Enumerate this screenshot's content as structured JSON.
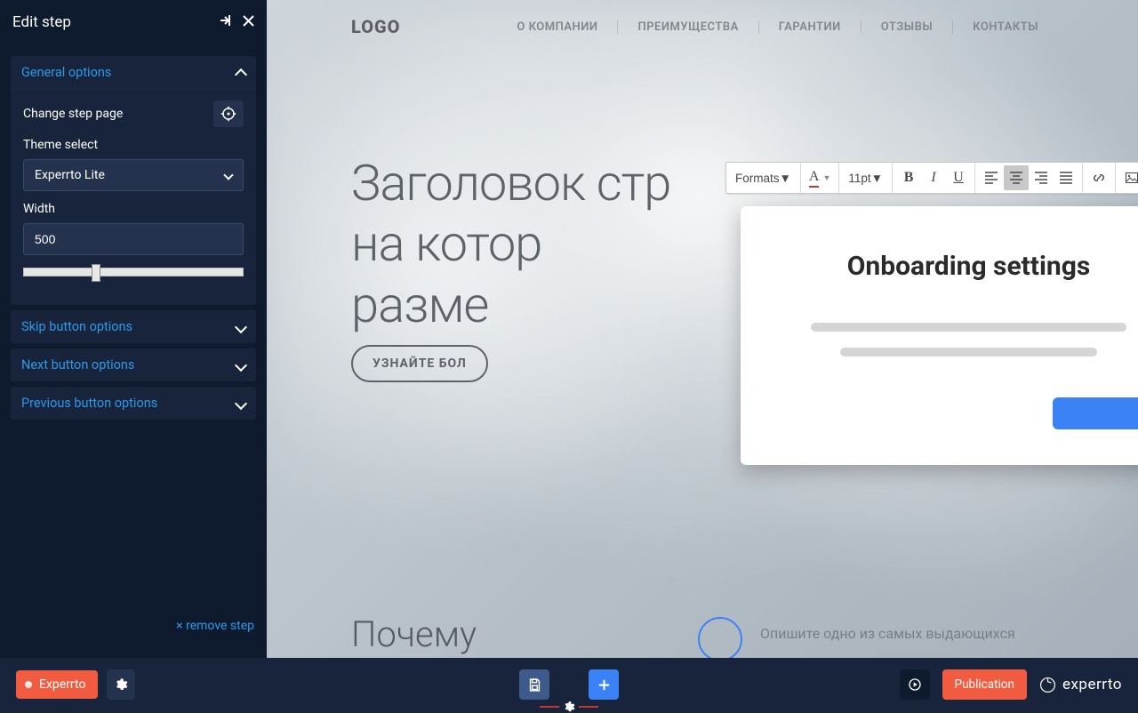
{
  "sidebar": {
    "title": "Edit step",
    "remove": "× remove step",
    "sections": {
      "general": {
        "label": "General options",
        "change_page": "Change step page",
        "theme_label": "Theme select",
        "theme_value": "Experrto Lite",
        "width_label": "Width",
        "width_value": "500"
      },
      "skip": {
        "label": "Skip button options"
      },
      "next": {
        "label": "Next button options"
      },
      "prev": {
        "label": "Previous button options"
      }
    }
  },
  "toolbar": {
    "formats": "Formats",
    "font_size": "11pt"
  },
  "tooltip": {
    "title": "Onboarding settings"
  },
  "page": {
    "logo": "LOGO",
    "nav": [
      "О КОМПАНИИ",
      "ПРЕИМУЩЕСТВА",
      "ГАРАНТИИ",
      "ОТЗЫВЫ",
      "КОНТАКТЫ"
    ],
    "hero_line1": "Заголовок стр",
    "hero_line2": "на котор",
    "hero_line3": "разме",
    "hero_btn": "УЗНАЙТЕ БОЛ",
    "section": "Почему",
    "feature": "Опишите одно из самых выдающихся"
  },
  "bottombar": {
    "product": "Experrto",
    "publish": "Publication",
    "brand": "experrto"
  }
}
